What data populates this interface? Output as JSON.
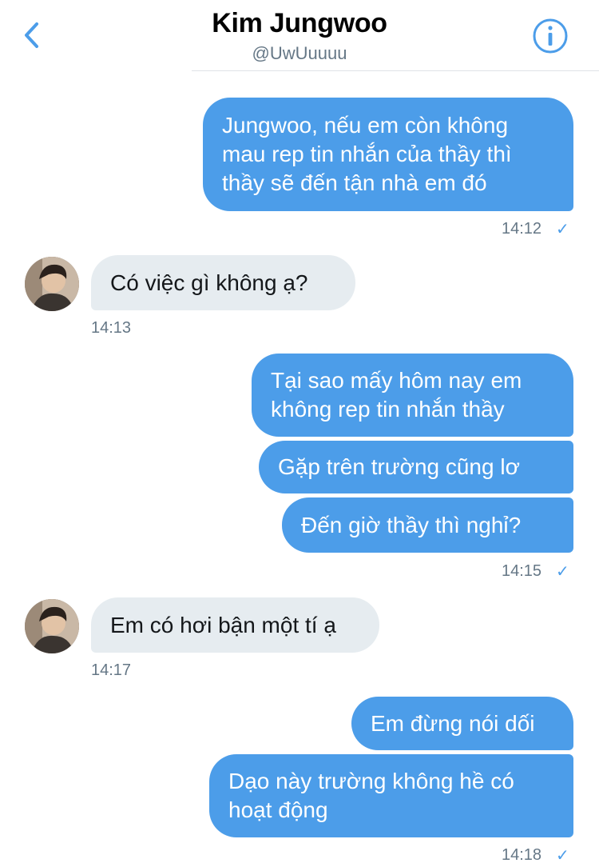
{
  "header": {
    "title": "Kim Jungwoo",
    "handle": "@UwUuuuu",
    "back_icon": "chevron-left-icon",
    "info_icon": "info-icon"
  },
  "colors": {
    "accent": "#4c9de9",
    "incoming_bubble": "#e6ecf0",
    "timestamp": "#657786"
  },
  "messages": {
    "m1": {
      "lines": [
        "Jungwoo, nếu em còn không",
        "mau rep tin nhắn của thầy thì",
        "thầy sẽ đến tận nhà em đó"
      ],
      "time": "14:12",
      "status": "✓"
    },
    "m2": {
      "text": "Có việc gì không ạ?",
      "time": "14:13"
    },
    "m3": {
      "lines": [
        "Tại sao mấy hôm nay em",
        "không rep tin nhắn thầy"
      ]
    },
    "m4": {
      "text": "Gặp trên trường cũng lơ"
    },
    "m5": {
      "text": "Đến giờ thầy thì nghỉ?",
      "time": "14:15",
      "status": "✓"
    },
    "m6": {
      "text": "Em có hơi bận một tí ạ",
      "time": "14:17"
    },
    "m7": {
      "text": "Em đừng nói dối"
    },
    "m8": {
      "lines": [
        "Dạo này trường không hề có",
        "hoạt động"
      ],
      "time": "14:18",
      "status": "✓"
    }
  }
}
